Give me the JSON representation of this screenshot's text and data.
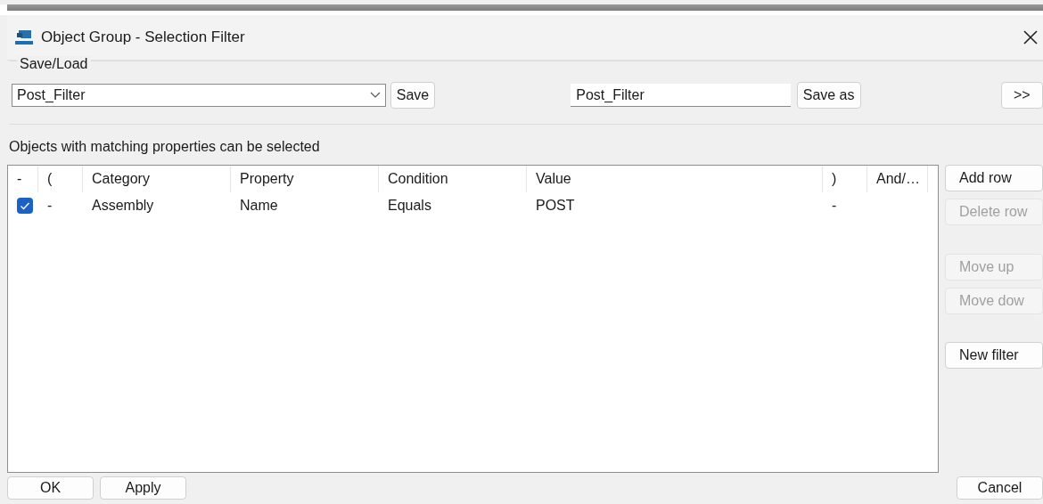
{
  "window": {
    "title": "Object Group - Selection Filter"
  },
  "save_load": {
    "label": "Save/Load",
    "filter_select": {
      "value": "Post_Filter"
    },
    "save_button": "Save",
    "name_field": {
      "value": "Post_Filter"
    },
    "save_as_button": "Save as",
    "expand_button": ">>"
  },
  "hint": "Objects with matching properties can be selected",
  "table": {
    "columns": [
      "-",
      "(",
      "Category",
      "Property",
      "Condition",
      "Value",
      ")",
      "And/…"
    ],
    "rows": [
      {
        "checked": true,
        "cells": [
          "",
          "-",
          "Assembly",
          "Name",
          "Equals",
          "POST",
          "-"
        ]
      }
    ]
  },
  "side_buttons": [
    {
      "label": "Add row",
      "disabled": false
    },
    {
      "label": "Delete row",
      "disabled": true
    },
    {
      "label": "Move up",
      "disabled": true
    },
    {
      "label": "Move dow",
      "disabled": true
    },
    {
      "label": "New filter",
      "disabled": false
    }
  ],
  "footer": {
    "left": [
      "OK",
      "Apply"
    ],
    "right": [
      "Cancel"
    ]
  }
}
